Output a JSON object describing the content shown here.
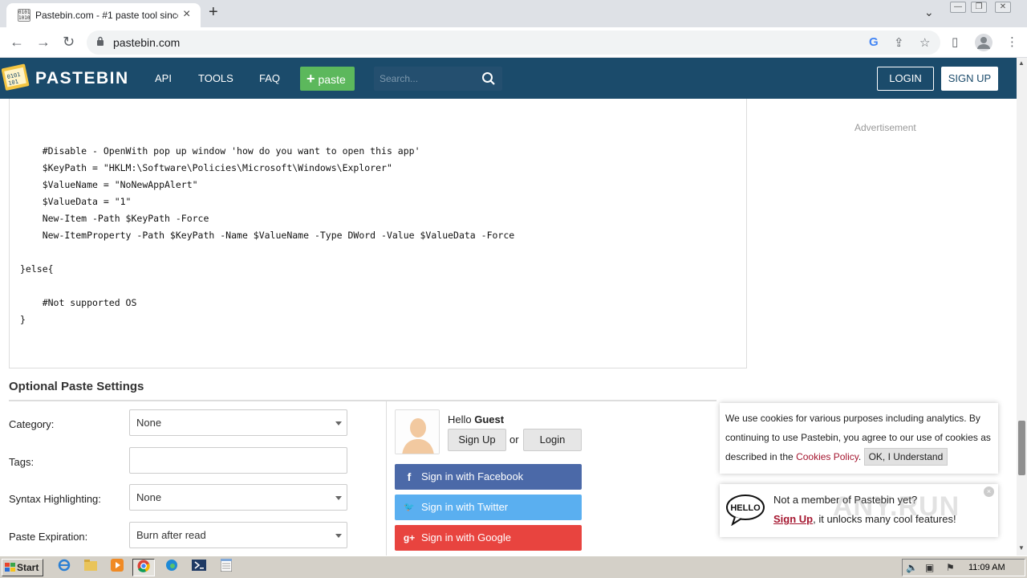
{
  "browser": {
    "tab_title": "Pastebin.com - #1 paste tool since 2002!",
    "tab_close": "×",
    "new_tab": "+",
    "tab_search": "⌄",
    "window_min": "—",
    "window_restore": "❐",
    "window_close": "✕",
    "back": "←",
    "forward": "→",
    "reload": "↻",
    "url": "pastebin.com",
    "favicon_text": "0101 1010",
    "google": "G",
    "share": "⇪",
    "star": "☆",
    "sidepanel": "▯",
    "menu": "⋮"
  },
  "header": {
    "brand": "PASTEBIN",
    "nav": [
      "API",
      "TOOLS",
      "FAQ"
    ],
    "paste_plus": "+",
    "paste_label": "paste",
    "search_placeholder": "Search...",
    "login": "LOGIN",
    "signup": "SIGN UP",
    "colors": {
      "bar": "#1b4b6b",
      "paste_button": "#5cb85c"
    }
  },
  "code": {
    "lines": [
      "    #Disable - OpenWith pop up window 'how do you want to open this app'",
      "    $KeyPath = \"HKLM:\\Software\\Policies\\Microsoft\\Windows\\Explorer\"",
      "    $ValueName = \"NoNewAppAlert\"",
      "    $ValueData = \"1\"",
      "    New-Item -Path $KeyPath -Force",
      "    New-ItemProperty -Path $KeyPath -Name $ValueName -Type DWord -Value $ValueData -Force",
      "",
      "}else{",
      "",
      "    #Not supported OS",
      "}"
    ]
  },
  "sidebar": {
    "advertisement": "Advertisement"
  },
  "settings": {
    "title": "Optional Paste Settings",
    "fields": [
      {
        "label": "Category:",
        "value": "None",
        "dropdown": true
      },
      {
        "label": "Tags:",
        "value": "",
        "dropdown": false
      },
      {
        "label": "Syntax Highlighting:",
        "value": "None",
        "dropdown": true
      },
      {
        "label": "Paste Expiration:",
        "value": "Burn after read",
        "dropdown": true
      }
    ]
  },
  "guest": {
    "hello": "Hello",
    "name": "Guest",
    "signup": "Sign Up",
    "or": "or",
    "login": "Login",
    "facebook": "Sign in with Facebook",
    "twitter": "Sign in with Twitter",
    "google": "Sign in with Google",
    "facebook_icon": "f",
    "twitter_icon": "🐦",
    "google_icon": "g+",
    "colors": {
      "facebook": "#4b69a8",
      "twitter": "#5aaff0",
      "google": "#e8443f"
    }
  },
  "cookie": {
    "text": "We use cookies for various purposes including analytics. By continuing to use Pastebin, you agree to our use of cookies as described in the ",
    "link": "Cookies Policy",
    "after": ".",
    "ok": "OK, I Understand"
  },
  "hello_popup": {
    "bubble": "HELLO",
    "line1": "Not a member of Pastebin yet?",
    "signup_link": "Sign Up",
    "line2_rest": ", it unlocks many cool features!",
    "close": "×"
  },
  "watermark": "ANY.RUN",
  "taskbar": {
    "start": "Start",
    "clock": "11:09 AM"
  }
}
